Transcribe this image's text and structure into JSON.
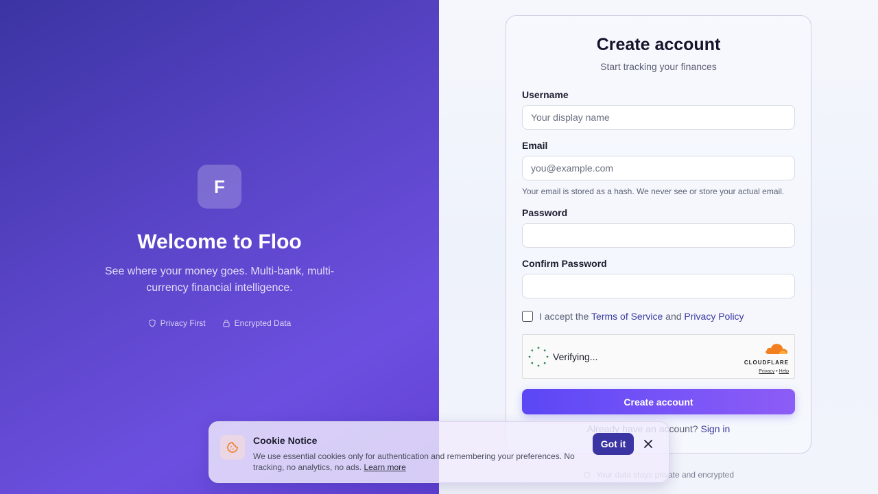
{
  "hero": {
    "logo_letter": "F",
    "title": "Welcome to Floo",
    "subtitle": "See where your money goes. Multi-bank, multi-currency financial intelligence.",
    "badges": [
      {
        "icon": "shield-icon",
        "label": "Privacy First"
      },
      {
        "icon": "lock-icon",
        "label": "Encrypted Data"
      }
    ]
  },
  "form": {
    "title": "Create account",
    "subtitle": "Start tracking your finances",
    "username_label": "Username",
    "username_placeholder": "Your display name",
    "email_label": "Email",
    "email_placeholder": "you@example.com",
    "email_hint": "Your email is stored as a hash. We never see or store your actual email.",
    "password_label": "Password",
    "confirm_label": "Confirm Password",
    "terms_prefix": "I accept the",
    "terms_link": "Terms of Service",
    "terms_and": "and",
    "privacy_link": "Privacy Policy",
    "submit_label": "Create account",
    "signin_prefix": "Already have an account?",
    "signin_link": "Sign in",
    "footer_note": "Your data stays private and encrypted"
  },
  "turnstile": {
    "status": "Verifying...",
    "brand": "CLOUDFLARE",
    "privacy": "Privacy",
    "separator": "•",
    "help": "Help"
  },
  "cookie": {
    "title": "Cookie Notice",
    "text": "We use essential cookies only for authentication and remembering your preferences. No tracking, no analytics, no ads.",
    "learn_more": "Learn more",
    "accept_label": "Got it"
  },
  "colors": {
    "accent": "#5b47f5",
    "hero_bg": "#5b45c9",
    "link": "#3b3aa0",
    "cloudflare": "#f38020"
  }
}
